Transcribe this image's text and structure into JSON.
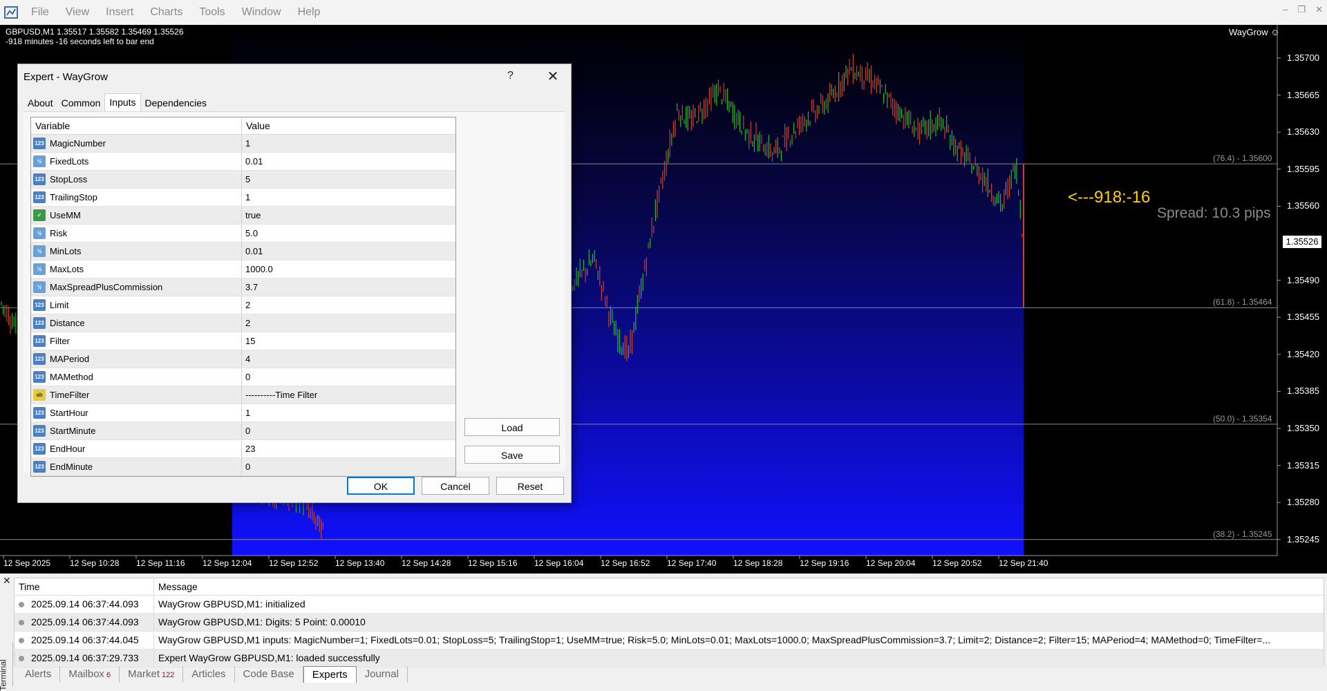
{
  "menu": [
    "File",
    "View",
    "Insert",
    "Charts",
    "Tools",
    "Window",
    "Help"
  ],
  "chart": {
    "header_line1": "GBPUSD,M1  1.35517 1.35582 1.35469 1.35526",
    "header_line2": "-918 minutes -16 seconds left to bar end",
    "ea_name": "WayGrow",
    "countdown": "<---918:-16",
    "spread": "Spread: 10.3 pips",
    "current_price": "1.35526",
    "price_axis": [
      "1.35700",
      "1.35665",
      "1.35630",
      "1.35595",
      "1.35560",
      "1.35490",
      "1.35455",
      "1.35420",
      "1.35385",
      "1.35350",
      "1.35315",
      "1.35280",
      "1.35245"
    ],
    "fib_levels": [
      "(76.4) - 1.35600",
      "(61.8) - 1.35464",
      "(50.0) - 1.35354",
      "(38.2) - 1.35245"
    ],
    "time_axis": [
      "12 Sep 2025",
      "12 Sep 10:28",
      "12 Sep 11:16",
      "12 Sep 12:04",
      "12 Sep 12:52",
      "12 Sep 13:40",
      "12 Sep 14:28",
      "12 Sep 15:16",
      "12 Sep 16:04",
      "12 Sep 16:52",
      "12 Sep 17:40",
      "12 Sep 18:28",
      "12 Sep 19:16",
      "12 Sep 20:04",
      "12 Sep 20:52",
      "12 Sep 21:40"
    ],
    "colors": {
      "bull": "#22c022",
      "bear": "#d04020",
      "bg": "#000000",
      "gradient": "#1010ff"
    }
  },
  "dialog": {
    "title": "Expert - WayGrow",
    "help": "?",
    "close": "✕",
    "tabs": [
      "About",
      "Common",
      "Inputs",
      "Dependencies"
    ],
    "active_tab": "Inputs",
    "col_variable": "Variable",
    "col_value": "Value",
    "params": [
      {
        "name": "MagicNumber",
        "value": "1",
        "type": "int"
      },
      {
        "name": "FixedLots",
        "value": "0.01",
        "type": "dbl"
      },
      {
        "name": "StopLoss",
        "value": "5",
        "type": "int"
      },
      {
        "name": "TrailingStop",
        "value": "1",
        "type": "int"
      },
      {
        "name": "UseMM",
        "value": "true",
        "type": "bool"
      },
      {
        "name": "Risk",
        "value": "5.0",
        "type": "dbl"
      },
      {
        "name": "MinLots",
        "value": "0.01",
        "type": "dbl"
      },
      {
        "name": "MaxLots",
        "value": "1000.0",
        "type": "dbl"
      },
      {
        "name": "MaxSpreadPlusCommission",
        "value": "3.7",
        "type": "dbl"
      },
      {
        "name": "Limit",
        "value": "2",
        "type": "int"
      },
      {
        "name": "Distance",
        "value": "2",
        "type": "int"
      },
      {
        "name": "Filter",
        "value": "15",
        "type": "int"
      },
      {
        "name": "MAPeriod",
        "value": "4",
        "type": "int"
      },
      {
        "name": "MAMethod",
        "value": "0",
        "type": "int"
      },
      {
        "name": "TimeFilter",
        "value": "----------Time Filter",
        "type": "str"
      },
      {
        "name": "StartHour",
        "value": "1",
        "type": "int"
      },
      {
        "name": "StartMinute",
        "value": "0",
        "type": "int"
      },
      {
        "name": "EndHour",
        "value": "23",
        "type": "int"
      },
      {
        "name": "EndMinute",
        "value": "0",
        "type": "int"
      }
    ],
    "icon_glyphs": {
      "int": "123",
      "dbl": "½",
      "bool": "✓",
      "str": "ab"
    },
    "buttons": {
      "load": "Load",
      "save": "Save",
      "ok": "OK",
      "cancel": "Cancel",
      "reset": "Reset"
    }
  },
  "terminal": {
    "side_label": "Terminal",
    "col_time": "Time",
    "col_message": "Message",
    "logs": [
      {
        "time": "2025.09.14 06:37:44.093",
        "message": "WayGrow GBPUSD,M1: initialized"
      },
      {
        "time": "2025.09.14 06:37:44.093",
        "message": "WayGrow GBPUSD,M1: Digits: 5 Point: 0.00010"
      },
      {
        "time": "2025.09.14 06:37:44.045",
        "message": "WayGrow GBPUSD,M1 inputs: MagicNumber=1; FixedLots=0.01; StopLoss=5; TrailingStop=1; UseMM=true; Risk=5.0; MinLots=0.01; MaxLots=1000.0; MaxSpreadPlusCommission=3.7; Limit=2; Distance=2; Filter=15; MAPeriod=4; MAMethod=0; TimeFilter=..."
      },
      {
        "time": "2025.09.14 06:37:29.733",
        "message": "Expert WayGrow GBPUSD,M1: loaded successfully"
      }
    ],
    "tabs": [
      {
        "label": "Alerts",
        "badge": ""
      },
      {
        "label": "Mailbox",
        "badge": "6"
      },
      {
        "label": "Market",
        "badge": "122"
      },
      {
        "label": "Articles",
        "badge": ""
      },
      {
        "label": "Code Base",
        "badge": ""
      },
      {
        "label": "Experts",
        "badge": ""
      },
      {
        "label": "Journal",
        "badge": ""
      }
    ],
    "active_tab": "Experts"
  }
}
